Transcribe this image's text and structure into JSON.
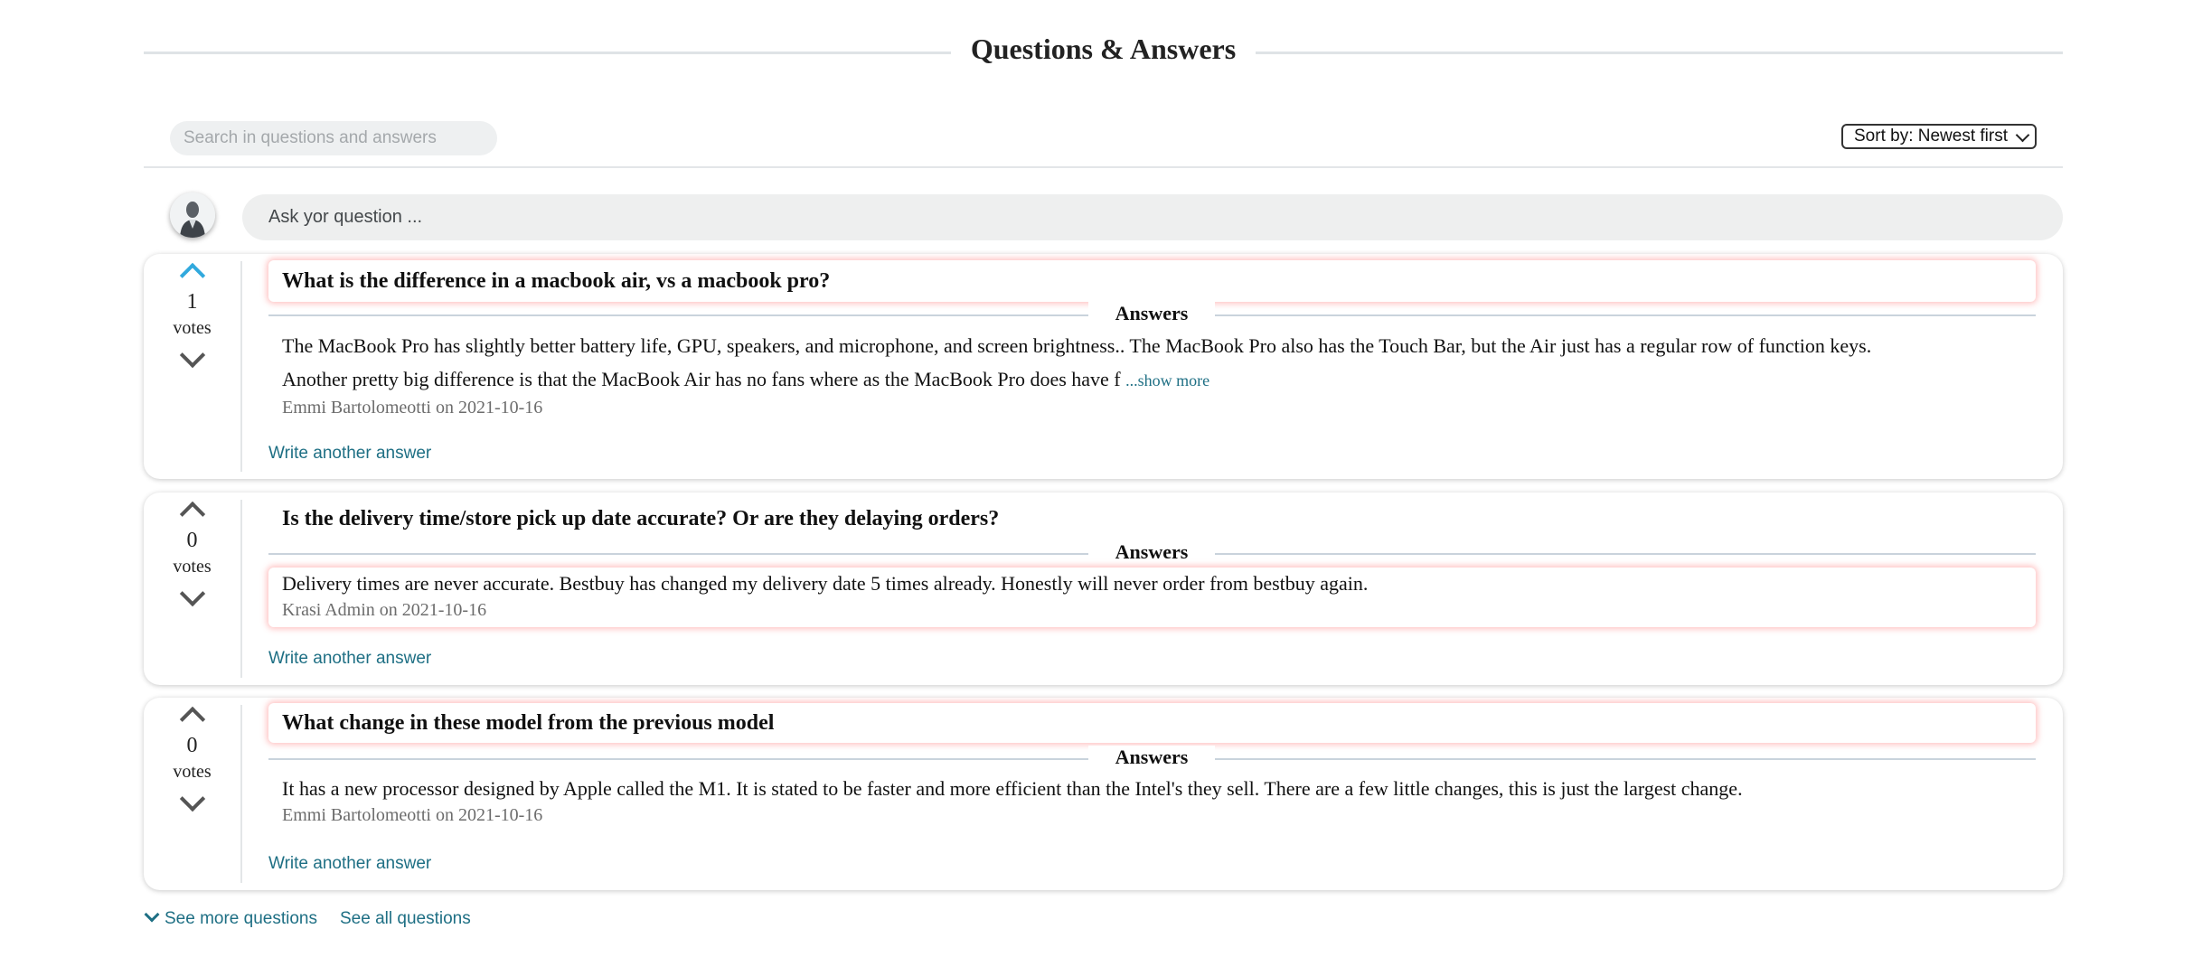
{
  "header": {
    "title": "Questions & Answers"
  },
  "search": {
    "placeholder": "Search in questions and answers"
  },
  "sort": {
    "label": "Sort by: Newest first"
  },
  "ask": {
    "placeholder": "Ask yor question ..."
  },
  "labels": {
    "votes": "votes",
    "answers": "Answers",
    "write_another": "Write another answer",
    "show_more": "...show more"
  },
  "questions": [
    {
      "votes": "1",
      "title": "What is the difference in a macbook air, vs a macbook pro?",
      "answer": "The MacBook Pro has slightly better battery life, GPU, speakers, and microphone, and screen brightness.. The MacBook Pro also has the Touch Bar, but the Air just has a regular row of function keys. Another pretty big difference is that the MacBook Air has no fans where as the MacBook Pro does have f",
      "author_line": "Emmi Bartolomeotti on 2021-10-16"
    },
    {
      "votes": "0",
      "title": "Is the delivery time/store pick up date accurate? Or are they delaying orders?",
      "answer": "Delivery times are never accurate. Bestbuy has changed my delivery date 5 times already. Honestly will never order from bestbuy again.",
      "author_line": "Krasi Admin on 2021-10-16"
    },
    {
      "votes": "0",
      "title": "What change in these model from the previous model",
      "answer": "It has a new processor designed by Apple called the M1. It is stated to be faster and more efficient than the Intel's they sell. There are a few little changes, this is just the largest change.",
      "author_line": "Emmi Bartolomeotti on 2021-10-16"
    }
  ],
  "footer": {
    "see_more": "See more questions",
    "see_all": "See all questions"
  },
  "colors": {
    "link": "#1e6f84",
    "upvote_active": "#31a9dd",
    "highlight": "#ff5c5c"
  }
}
